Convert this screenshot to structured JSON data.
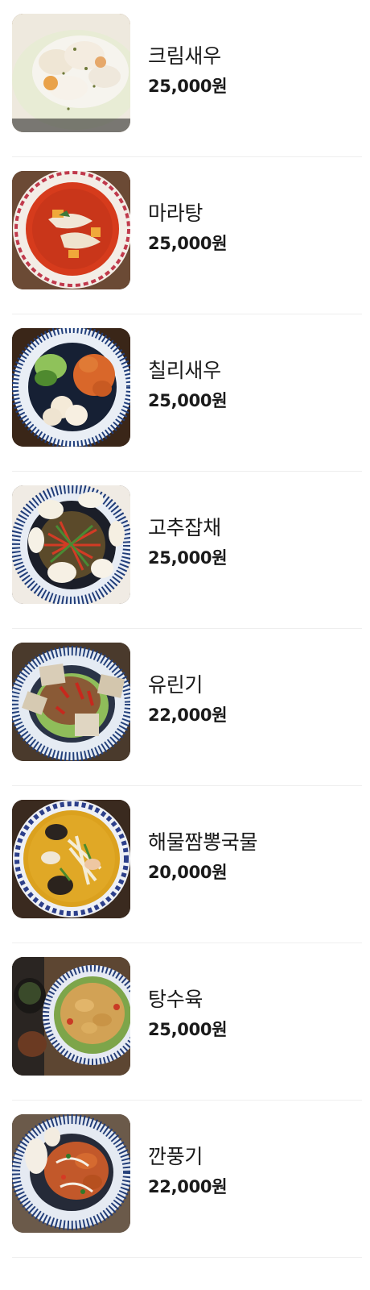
{
  "menu": {
    "items": [
      {
        "name": "크림새우",
        "price": "25,000원",
        "image": "cream-shrimp-dish-photo"
      },
      {
        "name": "마라탕",
        "price": "25,000원",
        "image": "malatang-dish-photo"
      },
      {
        "name": "칠리새우",
        "price": "25,000원",
        "image": "chili-shrimp-dish-photo"
      },
      {
        "name": "고추잡채",
        "price": "25,000원",
        "image": "gochu-japchae-dish-photo"
      },
      {
        "name": "유린기",
        "price": "22,000원",
        "image": "yuringi-dish-photo"
      },
      {
        "name": "해물짬뽕국물",
        "price": "20,000원",
        "image": "seafood-jjamppong-soup-photo"
      },
      {
        "name": "탕수육",
        "price": "25,000원",
        "image": "tangsuyuk-dish-photo"
      },
      {
        "name": "깐풍기",
        "price": "22,000원",
        "image": "kkanpunggi-dish-photo"
      }
    ]
  }
}
